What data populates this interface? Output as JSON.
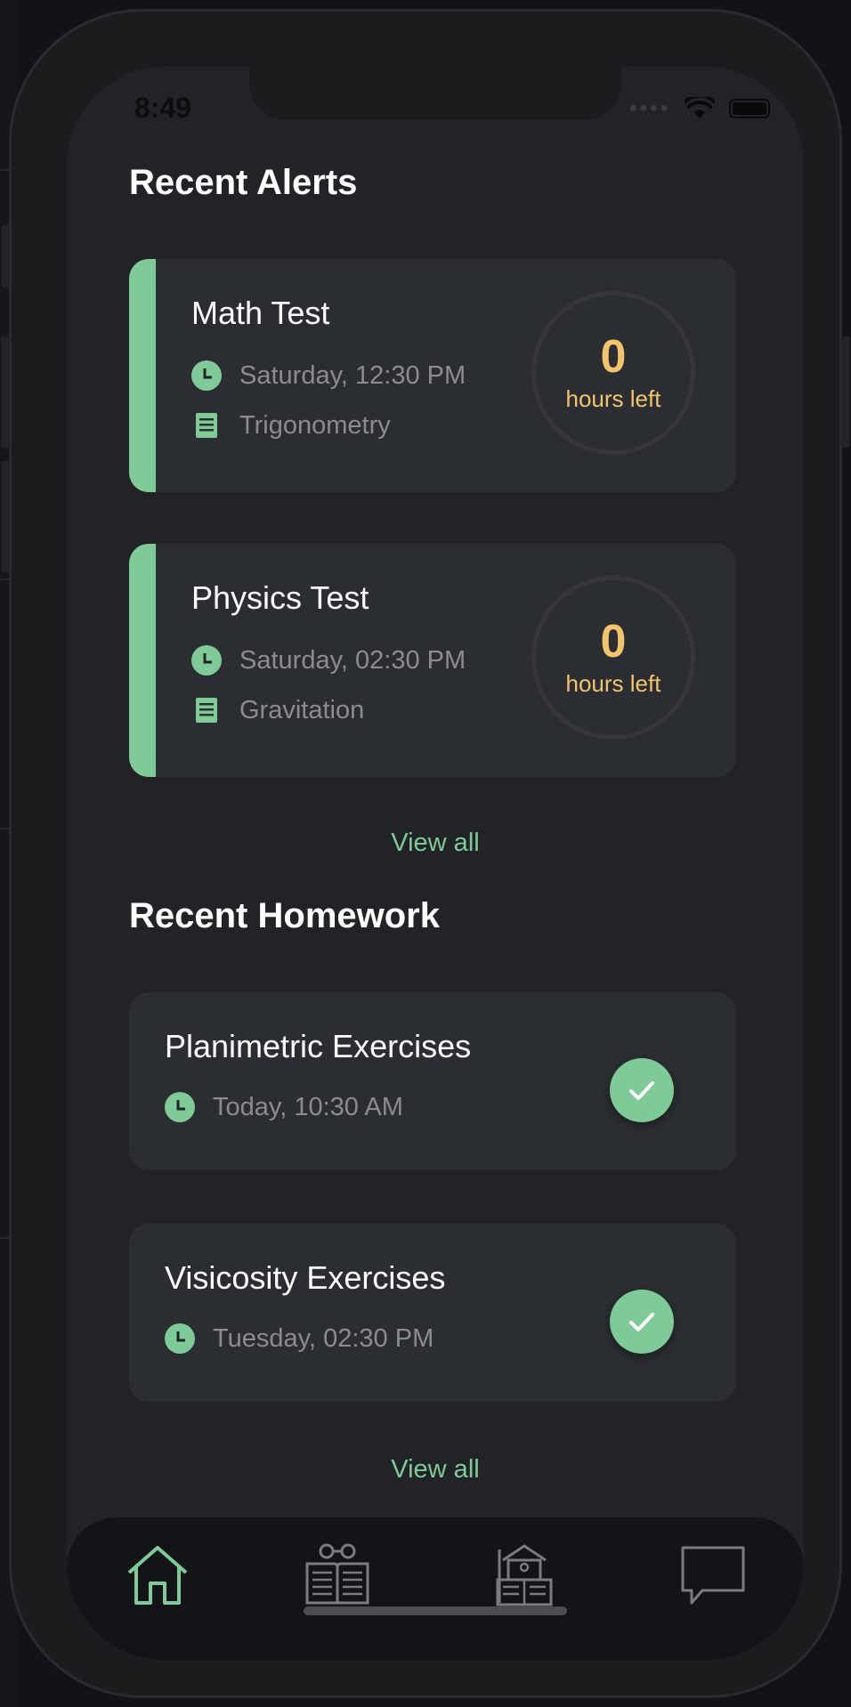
{
  "status_bar": {
    "time": "8:49"
  },
  "alerts": {
    "title": "Recent Alerts",
    "items": [
      {
        "title": "Math Test",
        "when": "Saturday, 12:30 PM",
        "topic": "Trigonometry",
        "hours": "0",
        "hours_label": "hours left"
      },
      {
        "title": "Physics Test",
        "when": "Saturday, 02:30 PM",
        "topic": "Gravitation",
        "hours": "0",
        "hours_label": "hours left"
      }
    ],
    "view_all": "View all"
  },
  "homework": {
    "title": "Recent Homework",
    "items": [
      {
        "title": "Planimetric Exercises",
        "when": "Today, 10:30 AM",
        "done": true
      },
      {
        "title": "Visicosity Exercises",
        "when": "Tuesday, 02:30 PM",
        "done": true
      }
    ],
    "view_all": "View all"
  },
  "tab_bar": {
    "items": [
      {
        "icon": "home-icon",
        "active": true
      },
      {
        "icon": "book-reader-icon",
        "active": false
      },
      {
        "icon": "school-book-icon",
        "active": false
      },
      {
        "icon": "chat-icon",
        "active": false
      }
    ]
  },
  "colors": {
    "accent": "#7fcb97",
    "warning": "#f2c56b",
    "card": "#2a2d31",
    "background": "#212327",
    "muted_text": "#8a8c90"
  }
}
